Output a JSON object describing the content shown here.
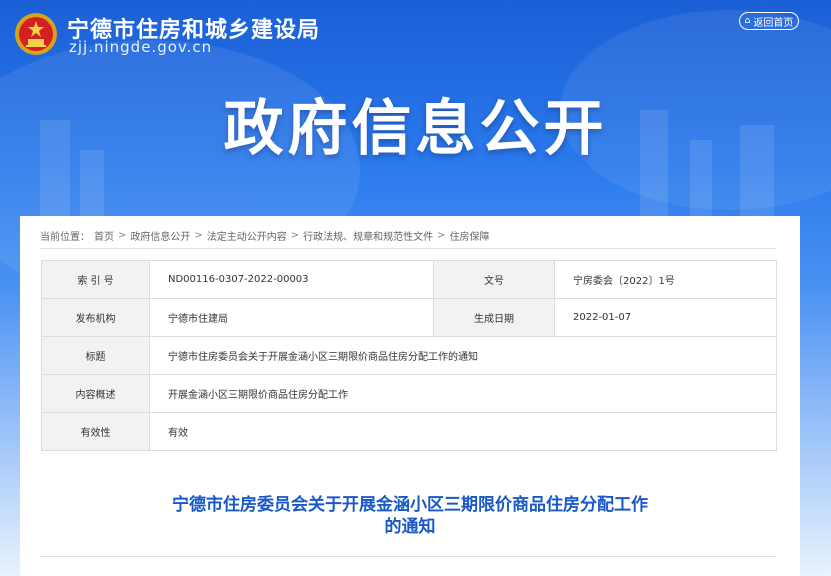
{
  "header": {
    "site_name": "宁德市住房和城乡建设局",
    "domain": "zjj.ningde.gov.cn",
    "home_button": "返回首页",
    "banner_title": "政府信息公开"
  },
  "breadcrumb": {
    "prefix": "当前位置：",
    "items": [
      "首页",
      "政府信息公开",
      "法定主动公开内容",
      "行政法规、规章和规范性文件",
      "住房保障"
    ],
    "separator": ">"
  },
  "info_table": {
    "index_label": "索 引 号",
    "index_value": "ND00116-0307-2022-00003",
    "doc_no_label": "文号",
    "doc_no_value": "宁房委会〔2022〕1号",
    "publisher_label": "发布机构",
    "publisher_value": "宁德市住建局",
    "date_label": "生成日期",
    "date_value": "2022-01-07",
    "title_label": "标题",
    "title_value": "宁德市住房委员会关于开展金涵小区三期限价商品住房分配工作的通知",
    "summary_label": "内容概述",
    "summary_value": "开展金涵小区三期限价商品住房分配工作",
    "validity_label": "有效性",
    "validity_value": "有效"
  },
  "article": {
    "title_line1": "宁德市住房委员会关于开展金涵小区三期限价商品住房分配工作",
    "title_line2": "的通知"
  },
  "colors": {
    "primary_blue": "#1958c7",
    "header_gradient_top": "#1b5fd6"
  }
}
